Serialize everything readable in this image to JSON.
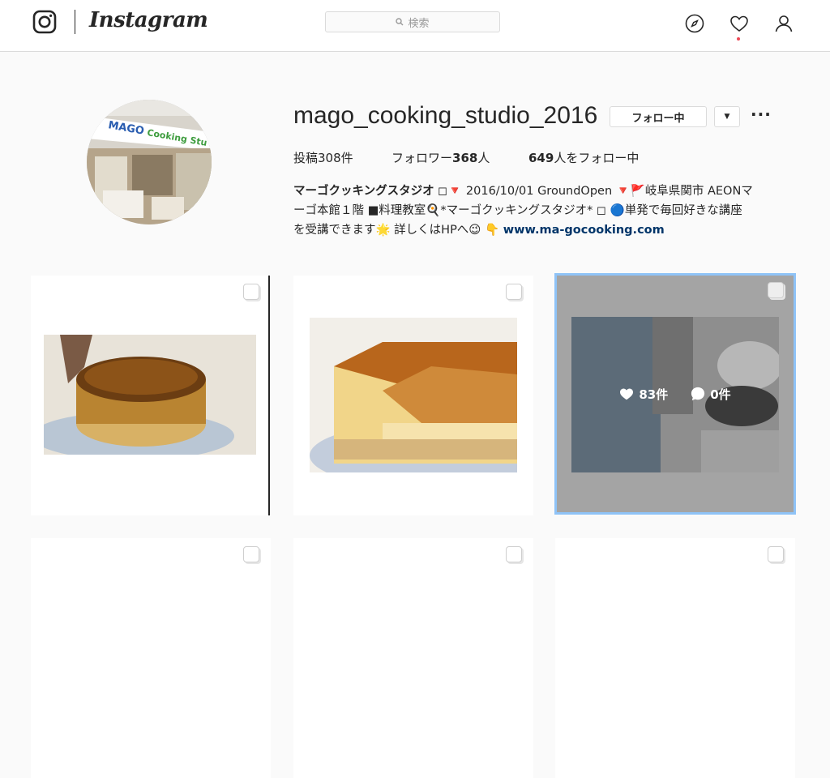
{
  "header": {
    "wordmark": "Instagram",
    "search_placeholder": "検索",
    "icons": [
      "instagram-logo-icon",
      "search-icon",
      "compass-icon",
      "heart-icon",
      "user-icon"
    ],
    "notification_dot_color": "#ed4956"
  },
  "profile": {
    "username": "mago_cooking_studio_2016",
    "follow_button": "フォロー中",
    "dropdown_glyph": "▼",
    "more_glyph": "···",
    "stats": {
      "posts_label": "投稿",
      "posts_count": "308",
      "posts_unit": "件",
      "followers_label": "フォロワー",
      "followers_count": "368",
      "followers_unit": "人",
      "following_count": "649",
      "following_label": "人をフォロー中"
    },
    "bio": {
      "name": "マーゴクッキングスタジオ",
      "line1": " ◻︎🔻 2016/10/01 GroundOpen 🔻🚩岐阜県関市 AEONマ",
      "line2": "ーゴ本館１階 ■料理教室🍳*マーゴクッキングスタジオ* ◻︎ 🔵単発で毎回好きな講座",
      "line3": "を受講できます🌟 詳しくはHPへ😉 👇 ",
      "link": "www.ma-gocooking.com"
    },
    "avatar_sign_text": "MAGO Cooking Studio"
  },
  "posts": [
    {
      "likes": "",
      "comments": ""
    },
    {
      "likes": "",
      "comments": ""
    },
    {
      "likes": "83件",
      "comments": "0件"
    },
    {
      "likes": "",
      "comments": ""
    },
    {
      "likes": "",
      "comments": ""
    },
    {
      "likes": "",
      "comments": ""
    }
  ],
  "colors": {
    "accent_selection": "#8fc3f7",
    "link": "#003569",
    "border": "#dbdbdb"
  }
}
